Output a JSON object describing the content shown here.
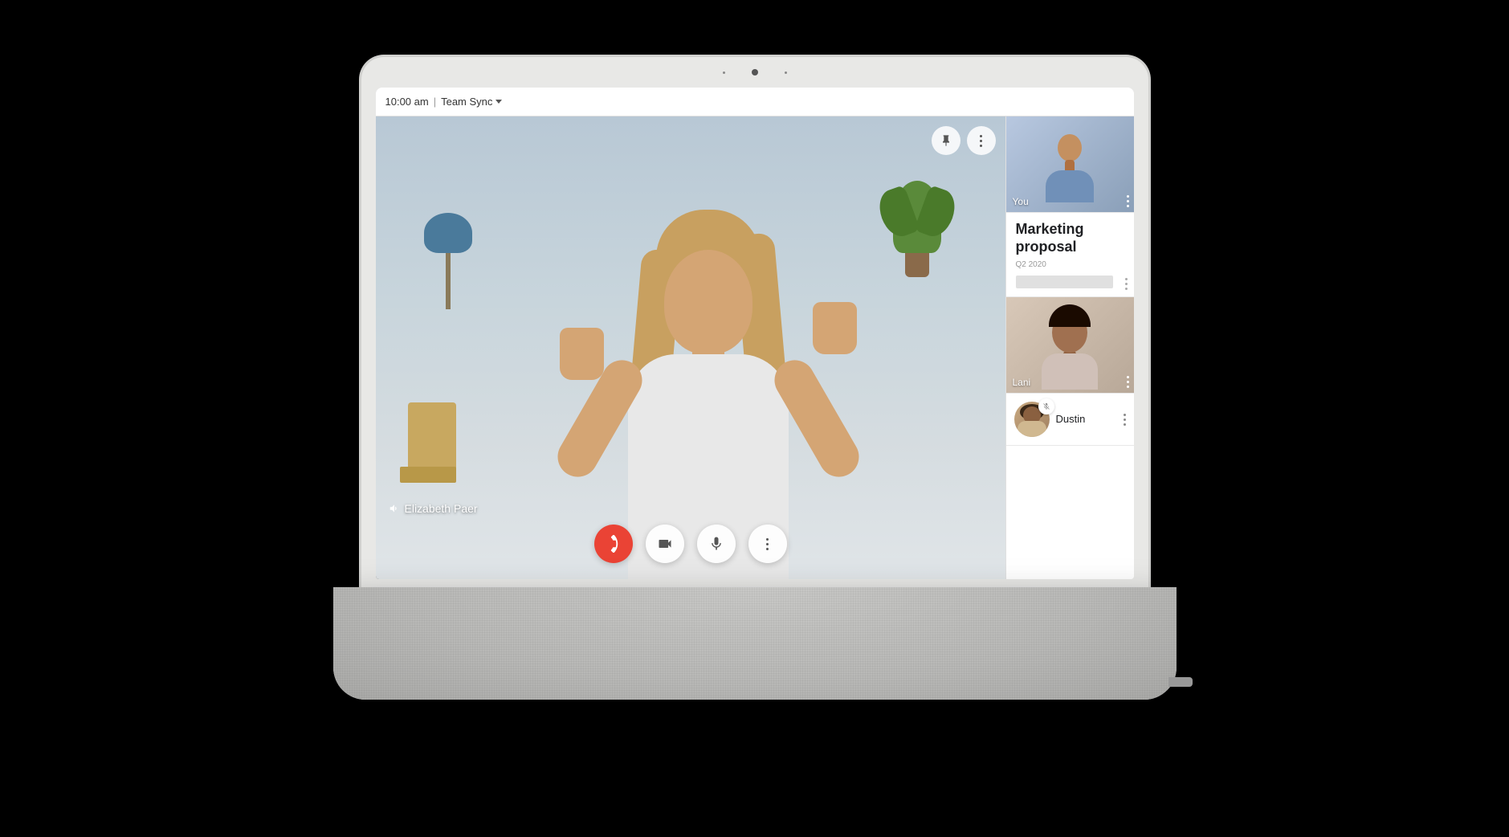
{
  "header": {
    "time": "10:00 am",
    "separator": "|",
    "meeting_name": "Team Sync",
    "dropdown_label": "Team Sync"
  },
  "main_video": {
    "participant_name": "Elizabeth Paer",
    "speaker_icon": "🔊"
  },
  "controls": {
    "hangup_label": "End call",
    "camera_label": "Toggle camera",
    "mic_label": "Toggle microphone",
    "more_label": "More options"
  },
  "right_panel": {
    "participants": [
      {
        "id": "you",
        "name": "You",
        "muted": false
      },
      {
        "id": "lani",
        "name": "Lani",
        "muted": false
      },
      {
        "id": "dustin",
        "name": "Dustin",
        "muted": true
      }
    ],
    "document": {
      "title": "Marketing proposal",
      "subtitle": "Q2 2020"
    }
  },
  "colors": {
    "hangup_red": "#ea4335",
    "white": "#ffffff",
    "light_bg": "#f5f5f5",
    "text_primary": "#202124",
    "text_secondary": "#5f6368"
  }
}
